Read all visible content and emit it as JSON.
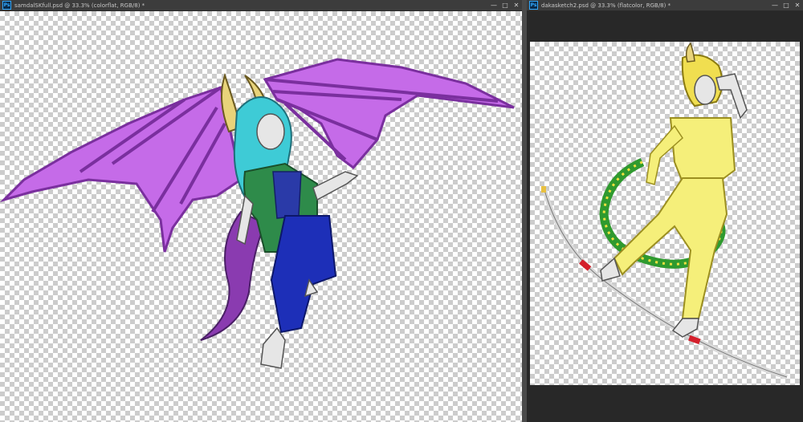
{
  "left_document": {
    "tab_title": "samdalSKfull.psd @ 33.3% (colorflat, RGB/8) *",
    "app_badge": "Ps",
    "window_buttons": {
      "minimize": "—",
      "maximize": "□",
      "close": "✕"
    },
    "canvas": "transparency-checkerboard",
    "artwork": "winged-dragon-character-flat-colors"
  },
  "right_document": {
    "tab_title": "dakasketch2.psd @ 33.3% (flatcolor, RGB/8) *",
    "app_badge": "Ps",
    "window_buttons": {
      "minimize": "—",
      "maximize": "□",
      "close": "✕"
    },
    "canvas": "transparency-checkerboard",
    "artwork": "dragon-character-with-bow-flat-colors"
  },
  "colors": {
    "wing": "#c56be8",
    "wing_outline": "#7a2f9e",
    "hair_left": "#3ecbd6",
    "jacket": "#2e8b4a",
    "shirt": "#2a3aa8",
    "pants_left": "#1d2fb8",
    "horn": "#e8d37a",
    "skin": "#e6e6e6",
    "tail_scale": "#8a3bb0",
    "outfit_right": "#f5ef7a",
    "hair_right": "#f0de50",
    "tail_right": "#2f9a2f",
    "bow_accent": "#d41f2b"
  }
}
